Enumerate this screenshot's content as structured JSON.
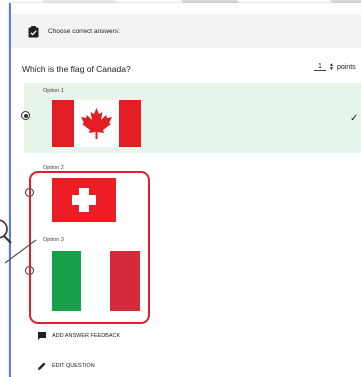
{
  "header": {
    "icon": "clipboard-check-icon",
    "label": "Choose correct answers:"
  },
  "question": {
    "text": "Which is the flag of Canada?",
    "points_value": "1",
    "points_unit": "points"
  },
  "options": [
    {
      "label": "Option 1",
      "flag": "canada-flag",
      "selected": true,
      "correct_mark": "✓"
    },
    {
      "label": "Option 2",
      "flag": "switzerland-flag",
      "selected": false
    },
    {
      "label": "Option 3",
      "flag": "italy-flag",
      "selected": false
    }
  ],
  "actions": {
    "feedback_label": "ADD ANSWER FEEDBACK",
    "edit_label": "EDIT QUESTION"
  },
  "colors": {
    "selected_option_bg": "#e6f4ea",
    "highlight_border": "#e0202a",
    "card_accent": "#5b7fdc"
  }
}
